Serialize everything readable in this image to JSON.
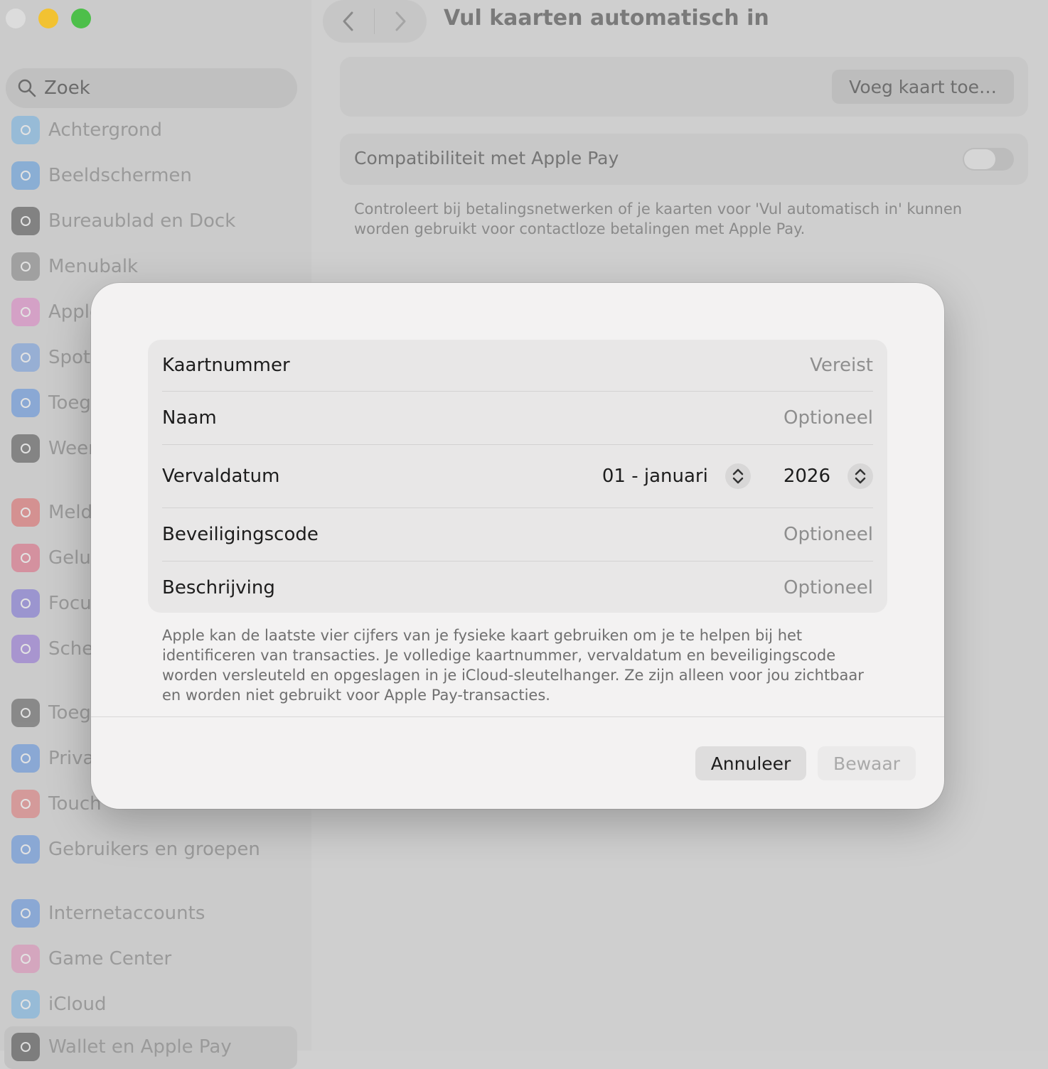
{
  "window": {
    "title": "Vul kaarten automatisch in"
  },
  "sidebar": {
    "search_placeholder": "Zoek",
    "items": [
      {
        "label": "Achtergrond",
        "icon": "flower-icon",
        "color": "#5aa9e6"
      },
      {
        "label": "Beeldschermen",
        "icon": "sun-icon",
        "color": "#3d8be0"
      },
      {
        "label": "Bureaublad en Dock",
        "icon": "dock-icon",
        "color": "#2b2b2b"
      },
      {
        "label": "Menubalk",
        "icon": "menubar-icon",
        "color": "#6e6e6e"
      },
      {
        "label": "Apple",
        "icon": "siri-icon",
        "color": "#e06fc0"
      },
      {
        "label": "Spot",
        "icon": "magnifier-icon",
        "color": "#5a8fe0"
      },
      {
        "label": "Toeg",
        "icon": "accessibility-icon",
        "color": "#3d7fe0"
      },
      {
        "label": "Weer",
        "icon": "screensaver-icon",
        "color": "#2f2f2f"
      },
      {
        "label": "Meld",
        "icon": "bell-icon",
        "color": "#e04c4c"
      },
      {
        "label": "Gelui",
        "icon": "speaker-icon",
        "color": "#e04c6c"
      },
      {
        "label": "Focu",
        "icon": "moon-icon",
        "color": "#6255d6"
      },
      {
        "label": "Sche",
        "icon": "hourglass-icon",
        "color": "#7e55d6"
      },
      {
        "label": "Toeg",
        "icon": "lock-icon",
        "color": "#3b3b3b"
      },
      {
        "label": "Priva",
        "icon": "hand-icon",
        "color": "#3d7fe0"
      },
      {
        "label": "Touch",
        "icon": "fingerprint-icon",
        "color": "#e06060"
      },
      {
        "label": "Gebruikers en groepen",
        "icon": "users-icon",
        "color": "#3d7fe0"
      },
      {
        "label": "Internetaccounts",
        "icon": "at-icon",
        "color": "#3d7fe0"
      },
      {
        "label": "Game Center",
        "icon": "gamecenter-icon",
        "color": "#e07ab0"
      },
      {
        "label": "iCloud",
        "icon": "cloud-icon",
        "color": "#5aa9e6"
      },
      {
        "label": "Wallet en Apple Pay",
        "icon": "wallet-icon",
        "color": "#2b2b2b"
      }
    ]
  },
  "main": {
    "add_card_button": "Voeg kaart toe…",
    "compat_label": "Compatibiliteit met Apple Pay",
    "compat_desc": "Controleert bij betalingsnetwerken of je kaarten voor 'Vul automatisch in' kunnen worden gebruikt voor contactloze betalingen met Apple Pay."
  },
  "dialog": {
    "fields": {
      "card_number": {
        "label": "Kaartnummer",
        "placeholder": "Vereist"
      },
      "name": {
        "label": "Naam",
        "placeholder": "Optioneel"
      },
      "expiry": {
        "label": "Vervaldatum",
        "month": "01 - januari",
        "year": "2026"
      },
      "security_code": {
        "label": "Beveiligingscode",
        "placeholder": "Optioneel"
      },
      "description": {
        "label": "Beschrijving",
        "placeholder": "Optioneel"
      }
    },
    "info_text": "Apple kan de laatste vier cijfers van je fysieke kaart gebruiken om je te helpen bij het identificeren van transacties. Je volledige kaartnummer, vervaldatum en beveiligingscode worden versleuteld en opgeslagen in je iCloud-sleutelhanger. Ze zijn alleen voor jou zichtbaar en worden niet gebruikt voor Apple Pay-transacties.",
    "cancel_label": "Annuleer",
    "save_label": "Bewaar"
  }
}
